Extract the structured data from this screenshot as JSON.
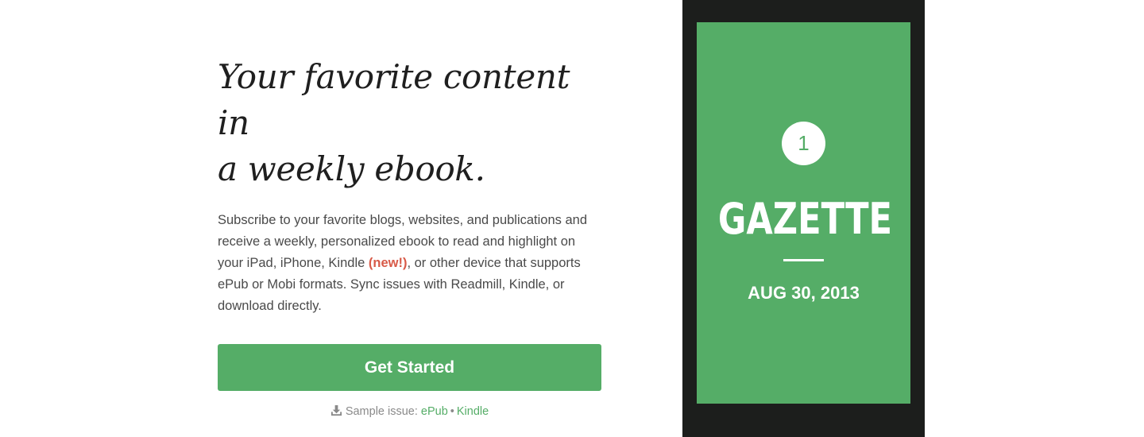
{
  "hero": {
    "headline_line1": "Your favorite content in",
    "headline_line2": "a weekly ebook.",
    "description_before": "Subscribe to your favorite blogs, websites, and publications and receive a weekly, personalized ebook to read and highlight on your iPad, iPhone, Kindle ",
    "new_badge": "(new!)",
    "description_after": ", or other device that supports ePub or Mobi formats. Sync issues with Readmill, Kindle, or download directly.",
    "cta_label": "Get Started",
    "sample_label": "Sample issue:",
    "sample_links": [
      {
        "label": "ePub"
      },
      {
        "label": "Kindle"
      }
    ],
    "sample_separator": "•",
    "download_icon": "download-icon"
  },
  "device_preview": {
    "issue_number": "1",
    "title": "GAZETTE",
    "date": "AUG 30, 2013"
  },
  "colors": {
    "accent": "#55ad67",
    "new_badge": "#d85a48",
    "device_frame": "#1c1e1c",
    "headline": "#1f1f1f",
    "body_text": "#4a4a4a",
    "muted_text": "#8a8a8a"
  }
}
